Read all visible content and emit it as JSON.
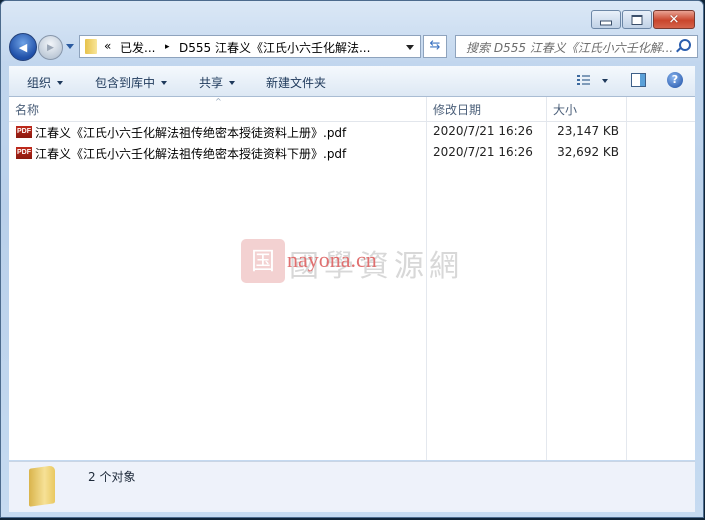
{
  "window": {
    "controls": {
      "minimize": "minimize",
      "maximize": "maximize",
      "close": "✕"
    }
  },
  "nav": {
    "back_icon": "◀",
    "forward_icon": "▶",
    "address": {
      "overflow": "«",
      "segment1": "已发...",
      "separator": "▸",
      "segment2": "D555 江春义《江氏小六壬化解法..."
    },
    "refresh_icon": "⇆",
    "search_placeholder": "搜索 D555 江春义《江氏小六壬化解..."
  },
  "toolbar": {
    "organize": "组织",
    "include_library": "包含到库中",
    "share": "共享",
    "new_folder": "新建文件夹",
    "help": "?"
  },
  "columns": {
    "name": "名称",
    "date": "修改日期",
    "size": "大小",
    "sort_indicator": "^"
  },
  "files": [
    {
      "icon": "PDF",
      "name": "江春义《江氏小六壬化解法祖传绝密本授徒资料上册》.pdf",
      "date": "2020/7/21 16:26",
      "size": "23,147 KB"
    },
    {
      "icon": "PDF",
      "name": "江春义《江氏小六壬化解法祖传绝密本授徒资料下册》.pdf",
      "date": "2020/7/21 16:26",
      "size": "32,692 KB"
    }
  ],
  "watermark": {
    "logo": "国",
    "chinese": "國學資源網",
    "english": "nayona.cn"
  },
  "status": {
    "count_text": "2 个对象"
  }
}
